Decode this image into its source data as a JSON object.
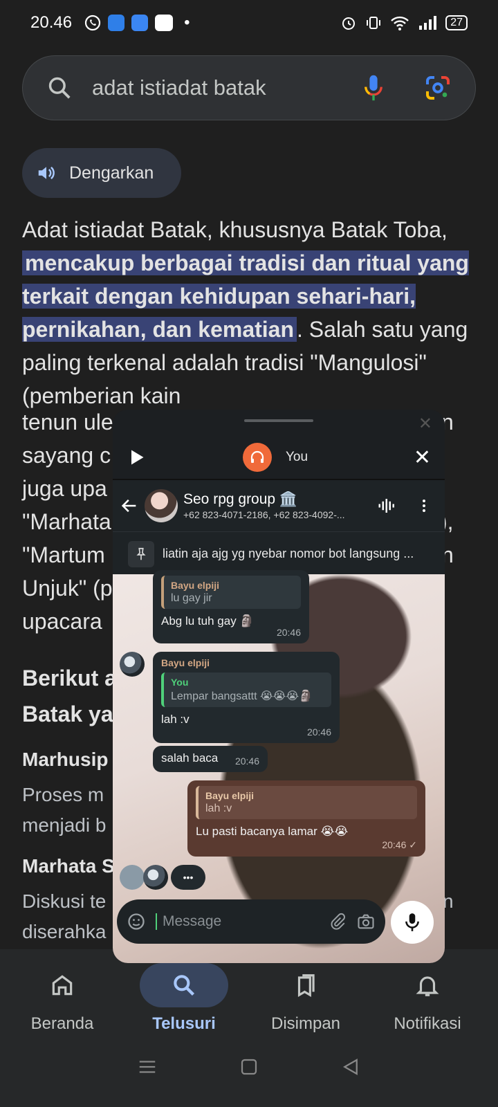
{
  "status": {
    "time": "20.46",
    "dot": "•",
    "battery": "27"
  },
  "search": {
    "query": "adat istiadat batak"
  },
  "listen": {
    "label": "Dengarkan"
  },
  "article": {
    "p1_before": "Adat istiadat Batak, khususnya Batak Toba, ",
    "p1_highlight": "mencakup berbagai tradisi dan ritual yang terkait dengan kehidupan sehari-hari, pernikahan, dan kematian",
    "p1_after": ". Salah satu yang paling terkenal adalah tradisi \"Mangulosi\" (pemberian kain",
    "lines": [
      "tenun ule",
      "sayang c",
      "juga upa",
      "\"Marhata",
      "\"Martum",
      "Unjuk\" (p",
      "upacara"
    ],
    "line_right_1": "n",
    "line_right_2": "),",
    "line_right_3": "n",
    "heading_1": "Berikut a",
    "heading_2": "Batak ya",
    "sub_1": "Marhusip",
    "body_1a": "Proses m",
    "body_1b": "menjadi b",
    "sub_2": "Marhata S",
    "body_2a": "Diskusi te",
    "body_2a_right": "n",
    "body_2b": "diserahka"
  },
  "bottom_nav": {
    "items": [
      {
        "label": "Beranda",
        "icon": "home-icon"
      },
      {
        "label": "Telusuri",
        "icon": "search-icon"
      },
      {
        "label": "Disimpan",
        "icon": "bookmark-icon"
      },
      {
        "label": "Notifikasi",
        "icon": "bell-icon"
      }
    ]
  },
  "chat_window": {
    "media_user": "You",
    "chat_title": "Seo rpg group 🏛️",
    "chat_subtitle": "+62 823-4071-2186, +62 823-4092-...",
    "pinned": "liatin aja ajg yg nyebar nomor bot langsung ...",
    "messages": [
      {
        "quote_name": "Bayu elpiji",
        "quote_text": "lu gay jir",
        "text": "Abg lu tuh gay 🗿",
        "time": "20:46"
      },
      {
        "sender": "Bayu elpiji",
        "quote_name": "You",
        "quote_text": "Lempar bangsattt 😭😭😭🗿",
        "text": "lah :v",
        "time": "20:46"
      },
      {
        "text": "salah baca",
        "time": "20:46"
      },
      {
        "quote_name": "Bayu elpiji",
        "quote_text": "lah :v",
        "text": "Lu pasti bacanya lamar 😭😭",
        "time": "20:46 ✓"
      }
    ],
    "typing": "•••",
    "composer_placeholder": "Message"
  }
}
